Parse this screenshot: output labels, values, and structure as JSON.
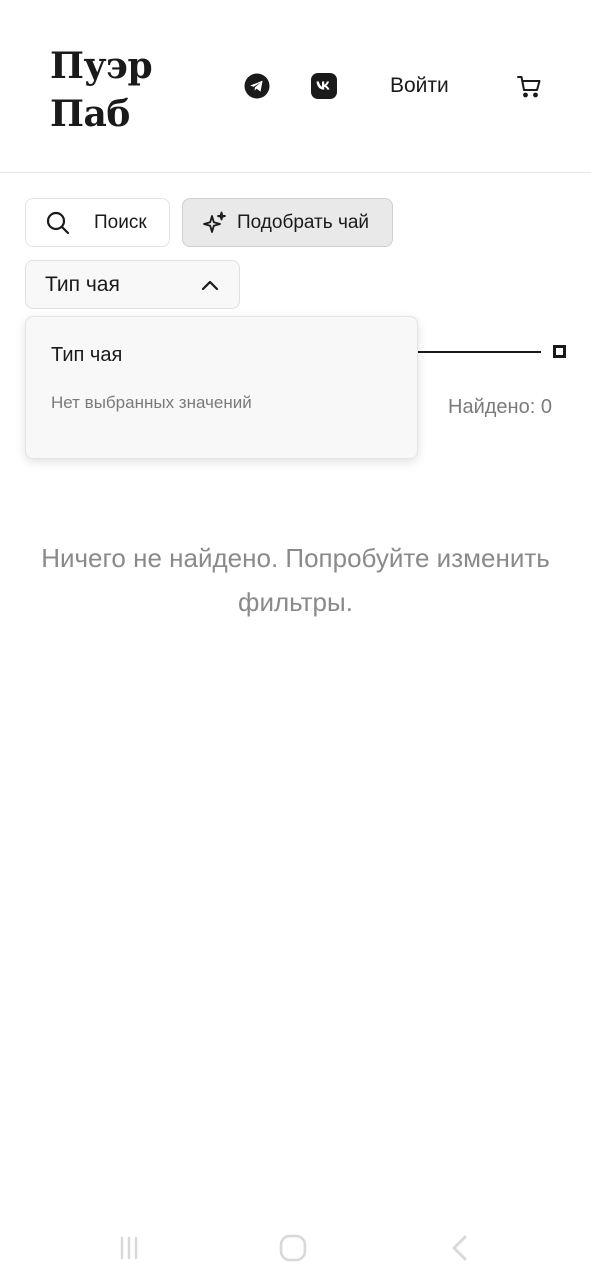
{
  "header": {
    "logo_line1": "Пуэр",
    "logo_line2": "Паб",
    "login_label": "Войти",
    "icons": [
      "telegram-icon",
      "vk-icon",
      "cart-icon"
    ]
  },
  "toolbar": {
    "search_label": "Поиск",
    "pick_tea_label": "Подобрать чай"
  },
  "filters": {
    "tea_type_label": "Тип чая",
    "dropdown": {
      "title": "Тип чая",
      "empty_text": "Нет выбранных значений"
    },
    "found_text": "Найдено: 0"
  },
  "results": {
    "empty_message": "Ничего не найдено. Попробуйте изменить фильтры."
  },
  "colors": {
    "text": "#1a1a1a",
    "muted": "#8a8a8a",
    "pick_button_bg": "#e9e9e9",
    "divider": "#e8e8e8"
  }
}
